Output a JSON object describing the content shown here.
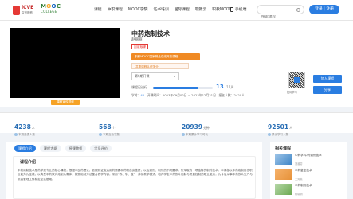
{
  "header": {
    "logo_icve": "iCVE",
    "logo_icve_sub": "智慧职教",
    "logo_mooc_letters": [
      "M",
      "O",
      "O",
      "C"
    ],
    "logo_mooc_sub": "COLLEGE",
    "nav": [
      "课程",
      "中职课程",
      "MOOC学院",
      "证书培训",
      "国际课程",
      "职教云",
      "职教MOOC"
    ],
    "mobile_label": "手机端",
    "search_placeholder": "搜索课程",
    "login_label": "登录 | 注册"
  },
  "course": {
    "cover_caption": "课程宣传视频",
    "title": "中药炮制技术",
    "teacher": "赵丽丽",
    "tag": "国家级课",
    "banner": "职教MOOC国家精品在线开放课程",
    "banner2": "共享课程认证学分",
    "select_value": "第6期开课",
    "progress_label": "课程已进行",
    "progress_value": "13",
    "progress_total": "/17周",
    "progress_fraction": 0.76,
    "dates_prefix": "学时：",
    "dates_hours": "40",
    "dates_text": "开课时间：2023年09月02日 ~ 2023年12月31日",
    "dates_suffix": "报名人数：2420人",
    "qr_label": "扫码学习",
    "join_label": "加入课程",
    "share_label": "分享"
  },
  "stats": [
    {
      "value": "4238",
      "unit": "人",
      "label": "本期选课人数"
    },
    {
      "value": "568",
      "unit": "个",
      "label": "本期互动次数"
    },
    {
      "value": "20939",
      "unit": "分钟",
      "label": "本期累计学习时长"
    },
    {
      "value": "92501",
      "unit": "人",
      "label": "累计学习人数"
    }
  ],
  "tabs": [
    "课程介绍",
    "课程大纲",
    "授课教师",
    "学员评价"
  ],
  "description": {
    "title": "课程介绍",
    "body": "中药炮制技术是药学类专业的核心课程，根据中医药理论，依照辨证施治用药需要和药物自身性质，以及调剂、制剂的不同要求，所采取的一项独特的制药技术。本课程以中药炮制岗位职业能力为主线，以典型中药饮片炮制为载体，按照炮制方法整合教学内容，采用“教、学、做”一体化教学模式，培养学生中药饮片炮制与质量控制的职业能力，为今后从事中药饮片生产与质量管理工作奠定坚实基础。"
  },
  "related": {
    "title": "相关课程",
    "items": [
      {
        "name": "中药学-中药调剂技术",
        "who": "刘淑芬"
      },
      {
        "name": "中药鉴定技术",
        "who": "王秀英"
      },
      {
        "name": "中药制剂技术",
        "who": "陈晓明"
      }
    ]
  },
  "colors": {
    "accent": "#2a7de1",
    "banner_orange": "#f08a24",
    "tag_red": "#e53935"
  }
}
